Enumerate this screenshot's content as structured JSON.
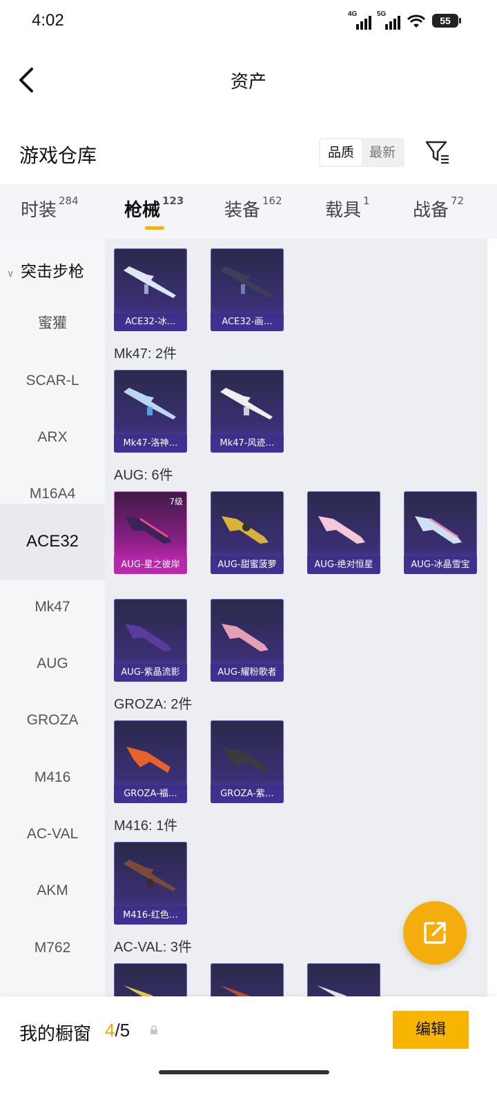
{
  "status": {
    "time": "4:02",
    "net1": "4G",
    "net2": "5G",
    "battery": "55"
  },
  "header": {
    "title": "资产"
  },
  "section": {
    "title": "游戏仓库",
    "sort": [
      "品质",
      "最新"
    ],
    "active_sort": "品质"
  },
  "tabs": [
    {
      "label": "时装",
      "count": "284"
    },
    {
      "label": "枪械",
      "count": "123"
    },
    {
      "label": "装备",
      "count": "162"
    },
    {
      "label": "载具",
      "count": "1"
    },
    {
      "label": "战备",
      "count": "72"
    }
  ],
  "sidebar": {
    "category": "突击步枪",
    "items": [
      "蜜獾",
      "SCAR-L",
      "ARX",
      "M16A4",
      "ACE32",
      "Mk47",
      "AUG",
      "GROZA",
      "M416",
      "AC-VAL",
      "AKM",
      "M762"
    ],
    "selected": "ACE32"
  },
  "groups": [
    {
      "label": "",
      "items": [
        {
          "name": "ACE32-冰…"
        },
        {
          "name": "ACE32-画…"
        }
      ]
    },
    {
      "label": "Mk47: 2件",
      "items": [
        {
          "name": "Mk47-洛神…"
        },
        {
          "name": "Mk47-风迹…"
        }
      ]
    },
    {
      "label": "AUG: 6件",
      "items": [
        {
          "name": "AUG-星之彼岸",
          "level": "7级"
        },
        {
          "name": "AUG-甜蜜菠萝"
        },
        {
          "name": "AUG-绝对恒星"
        },
        {
          "name": "AUG-冰晶雪宝"
        },
        {
          "name": "AUG-紫晶流影"
        },
        {
          "name": "AUG-耀粉歌者"
        }
      ]
    },
    {
      "label": "GROZA: 2件",
      "items": [
        {
          "name": "GROZA-福…"
        },
        {
          "name": "GROZA-紫…"
        }
      ]
    },
    {
      "label": "M416: 1件",
      "items": [
        {
          "name": "M416-红色…"
        }
      ]
    },
    {
      "label": "AC-VAL: 3件",
      "items": [
        {
          "name": ""
        },
        {
          "name": ""
        },
        {
          "name": ""
        }
      ]
    }
  ],
  "bottom": {
    "title": "我的橱窗",
    "current": "4",
    "total": "/5",
    "edit": "编辑"
  },
  "colors": {
    "accent": "#f5b300",
    "card_purple": "#5a43b3",
    "card_gold_pink": "#d52eba"
  }
}
